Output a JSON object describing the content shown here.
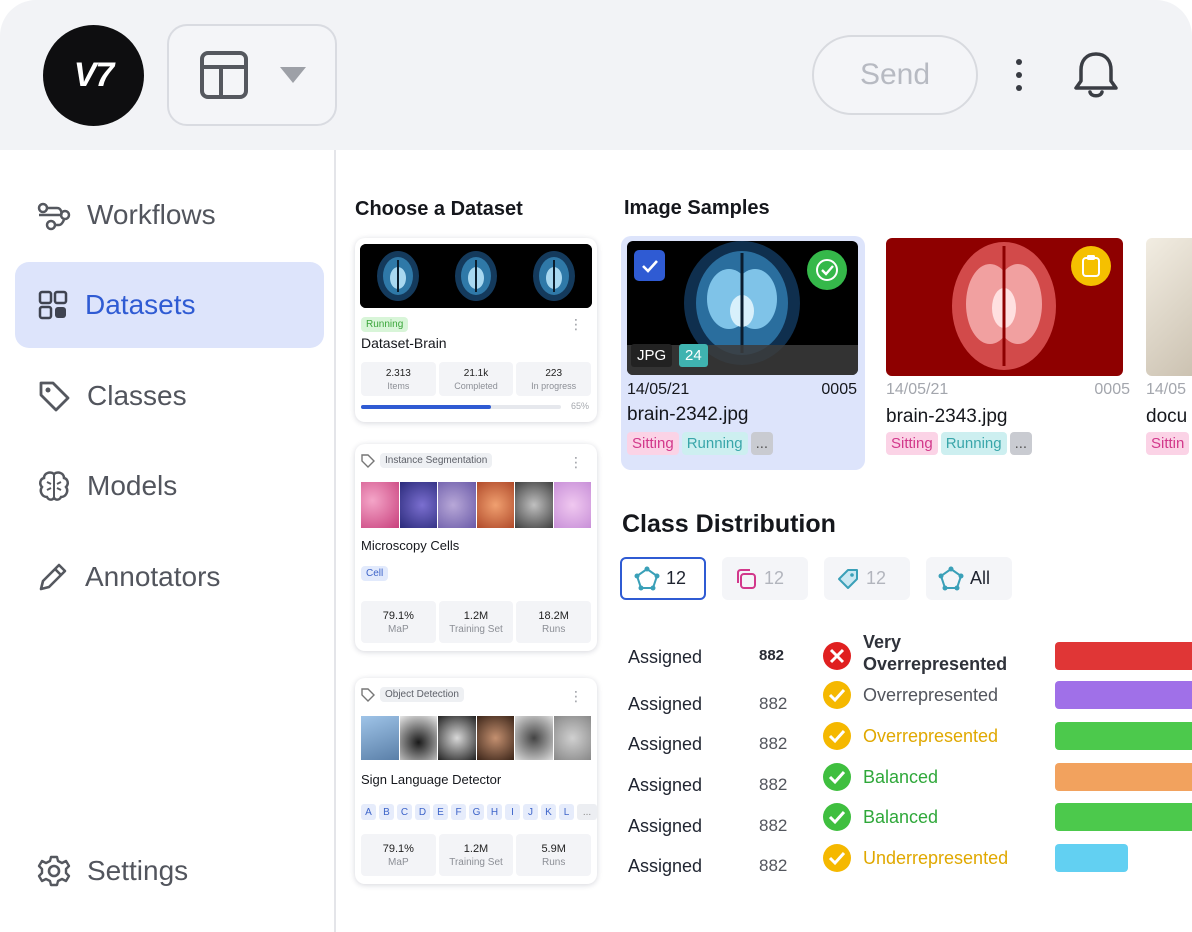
{
  "header": {
    "logo_text": "V7",
    "send_label": "Send"
  },
  "sidebar": {
    "items": [
      {
        "label": "Workflows",
        "icon": "workflows-icon"
      },
      {
        "label": "Datasets",
        "icon": "grid-icon",
        "active": true
      },
      {
        "label": "Classes",
        "icon": "tag-icon"
      },
      {
        "label": "Models",
        "icon": "brain-icon"
      },
      {
        "label": "Annotators",
        "icon": "pencil-icon"
      }
    ],
    "settings_label": "Settings"
  },
  "datasets": {
    "title": "Choose a Dataset",
    "cards": [
      {
        "status": "Running",
        "name": "Dataset-Brain",
        "stats": [
          {
            "value": "2.313",
            "label": "Items"
          },
          {
            "value": "21.1k",
            "label": "Completed"
          },
          {
            "value": "223",
            "label": "In progress"
          }
        ],
        "progress_label": "65%",
        "progress": 0.65
      },
      {
        "type": "Instance Segmentation",
        "name": "Microscopy Cells",
        "class_tag": "Cell",
        "stats": [
          {
            "value": "79.1%",
            "label": "MaP"
          },
          {
            "value": "1.2M",
            "label": "Training Set"
          },
          {
            "value": "18.2M",
            "label": "Runs"
          }
        ]
      },
      {
        "type": "Object Detection",
        "name": "Sign Language Detector",
        "letters": [
          "A",
          "B",
          "C",
          "D",
          "E",
          "F",
          "G",
          "H",
          "I",
          "J",
          "K",
          "L",
          "..."
        ],
        "stats": [
          {
            "value": "79.1%",
            "label": "MaP"
          },
          {
            "value": "1.2M",
            "label": "Training Set"
          },
          {
            "value": "5.9M",
            "label": "Runs"
          }
        ]
      }
    ]
  },
  "samples": {
    "title": "Image Samples",
    "items": [
      {
        "format": "JPG",
        "count": "24",
        "date": "14/05/21",
        "id": "0005",
        "filename": "brain-2342.jpg",
        "tags": [
          "Sitting",
          "Running",
          "..."
        ]
      },
      {
        "date": "14/05/21",
        "id": "0005",
        "filename": "brain-2343.jpg",
        "tags": [
          "Sitting",
          "Running",
          "..."
        ]
      },
      {
        "date": "14/05",
        "filename": "docu",
        "tags": [
          "Sittin"
        ]
      }
    ]
  },
  "class_distribution": {
    "title": "Class Distribution",
    "filters": [
      {
        "label": "12",
        "icon": "polygon-icon",
        "active": true
      },
      {
        "label": "12",
        "icon": "copy-icon"
      },
      {
        "label": "12",
        "icon": "tag-icon"
      },
      {
        "label": "All",
        "icon": "polygon-icon"
      }
    ],
    "rows": [
      {
        "label": "Assigned",
        "count": "882",
        "status": "Very Overrepresented",
        "status_line1": "Very",
        "status_line2": "Overrepresented",
        "kind": "error",
        "bar_color": "#e03636",
        "bar_fraction": 1.0
      },
      {
        "label": "Assigned",
        "count": "882",
        "status": "Overrepresented",
        "kind": "warn",
        "bar_color": "#a070e8",
        "bar_fraction": 1.0
      },
      {
        "label": "Assigned",
        "count": "882",
        "status": "Overrepresented",
        "kind": "warn",
        "bar_color": "#4cc94c",
        "bar_fraction": 1.0
      },
      {
        "label": "Assigned",
        "count": "882",
        "status": "Balanced",
        "kind": "ok",
        "bar_color": "#f2a25e",
        "bar_fraction": 1.0
      },
      {
        "label": "Assigned",
        "count": "882",
        "status": "Balanced",
        "kind": "ok",
        "bar_color": "#4cc94c",
        "bar_fraction": 1.0
      },
      {
        "label": "Assigned",
        "count": "882",
        "status": "Underrepresented",
        "kind": "warn",
        "bar_color": "#62d0f2",
        "bar_fraction": 0.53
      }
    ]
  },
  "colors": {
    "accent": "#2f5bd3",
    "ok": "#3fbf3f",
    "warn": "#f5b800",
    "error": "#e02020"
  }
}
